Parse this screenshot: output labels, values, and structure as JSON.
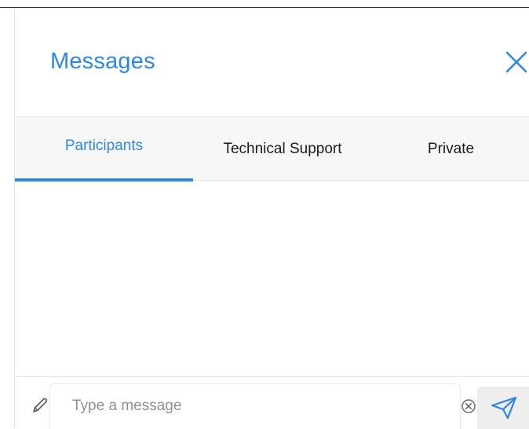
{
  "panel": {
    "title": "Messages"
  },
  "tabs": [
    {
      "label": "Participants",
      "active": true
    },
    {
      "label": "Technical Support",
      "active": false
    },
    {
      "label": "Private",
      "active": false
    }
  ],
  "composer": {
    "placeholder": "Type a message",
    "value": ""
  },
  "icons": {
    "close": "close-icon",
    "edit": "pencil-icon",
    "clear": "clear-circle-icon",
    "send": "send-icon"
  },
  "colors": {
    "accent": "#2b88e6",
    "tab_bar_bg": "#f7f7f7",
    "send_button_bg": "#eeeeee"
  }
}
